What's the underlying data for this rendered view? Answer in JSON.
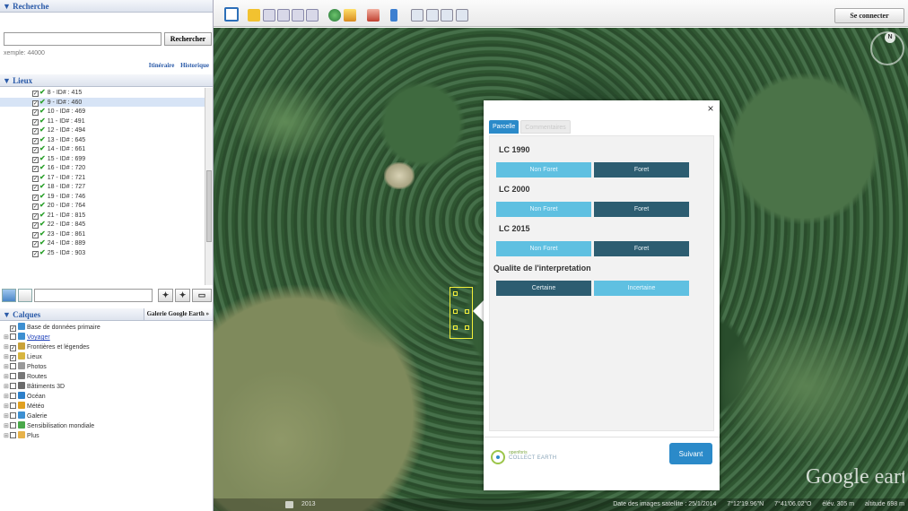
{
  "search": {
    "title": "▼ Recherche",
    "button": "Rechercher",
    "hint": "xemple: 44000",
    "links": [
      "Itinéraire",
      "Historique"
    ]
  },
  "places": {
    "title": "▼ Lieux",
    "items": [
      {
        "label": "8 - ID# : 415"
      },
      {
        "label": "9 - ID# : 460",
        "selected": true
      },
      {
        "label": "10 - ID# : 469"
      },
      {
        "label": "11 - ID# : 491"
      },
      {
        "label": "12 - ID# : 494"
      },
      {
        "label": "13 - ID# : 645"
      },
      {
        "label": "14 - ID# : 661"
      },
      {
        "label": "15 - ID# : 699"
      },
      {
        "label": "16 - ID# : 720"
      },
      {
        "label": "17 - ID# : 721"
      },
      {
        "label": "18 - ID# : 727"
      },
      {
        "label": "19 - ID# : 746"
      },
      {
        "label": "20 - ID# : 764"
      },
      {
        "label": "21 - ID# : 815"
      },
      {
        "label": "22 - ID# : 845"
      },
      {
        "label": "23 - ID# : 861"
      },
      {
        "label": "24 - ID# : 889"
      },
      {
        "label": "25 - ID# : 903"
      }
    ]
  },
  "layers": {
    "title": "▼ Calques",
    "gallery_button": "Galerie Google Earth »",
    "items": [
      {
        "label": "Base de données primaire",
        "icon": "globe-icon",
        "color": "#3d8fd1"
      },
      {
        "label": "Voyager",
        "icon": "voyager-icon",
        "color": "#3d8fd1",
        "link": true
      },
      {
        "label": "Frontières et légendes",
        "icon": "flag-icon",
        "color": "#c9a23a"
      },
      {
        "label": "Lieux",
        "icon": "folder-icon",
        "color": "#d7b540"
      },
      {
        "label": "Photos",
        "icon": "camera-icon",
        "color": "#999999"
      },
      {
        "label": "Routes",
        "icon": "road-icon",
        "color": "#777777"
      },
      {
        "label": "Bâtiments 3D",
        "icon": "building-icon",
        "color": "#6a6a6a"
      },
      {
        "label": "Océan",
        "icon": "ocean-icon",
        "color": "#2d7fc9"
      },
      {
        "label": "Météo",
        "icon": "weather-icon",
        "color": "#e0a020"
      },
      {
        "label": "Galerie",
        "icon": "star-icon",
        "color": "#3d8fd1"
      },
      {
        "label": "Sensibilisation mondiale",
        "icon": "globe-icon",
        "color": "#4aa84a"
      },
      {
        "label": "Plus",
        "icon": "folder-icon",
        "color": "#e7b24a"
      }
    ]
  },
  "topbar": {
    "connect_button": "Se connecter"
  },
  "map": {
    "year": "2013",
    "status": [
      "Date des images satellite : 25/1/2014",
      "7°12'19.96\"N",
      "7°41'06.02\"O",
      "élév. 305 m",
      "altitude  698 m"
    ],
    "logo": "Google earth"
  },
  "dialog": {
    "tabs": [
      "Parcelle",
      "Commentaires"
    ],
    "questions": [
      {
        "label": "LC 1990",
        "options": [
          "Non Foret",
          "Foret"
        ],
        "selected": 1
      },
      {
        "label": "LC 2000",
        "options": [
          "Non Foret",
          "Foret"
        ],
        "selected": 1
      },
      {
        "label": "LC 2015",
        "options": [
          "Non Foret",
          "Foret"
        ],
        "selected": 1
      },
      {
        "label": "Qualite de l'interpretation",
        "options": [
          "Certaine",
          "Incertaine"
        ],
        "selected": 0
      }
    ],
    "logo_line1": "openforis",
    "logo_line2": "COLLECT EARTH",
    "next_button": "Suivant",
    "close": "×"
  },
  "colors": {
    "accent": "#2b8ac9",
    "option_light": "#5fc0e1",
    "option_dark": "#2d5d71",
    "plot_outline": "#f4ef3a"
  }
}
